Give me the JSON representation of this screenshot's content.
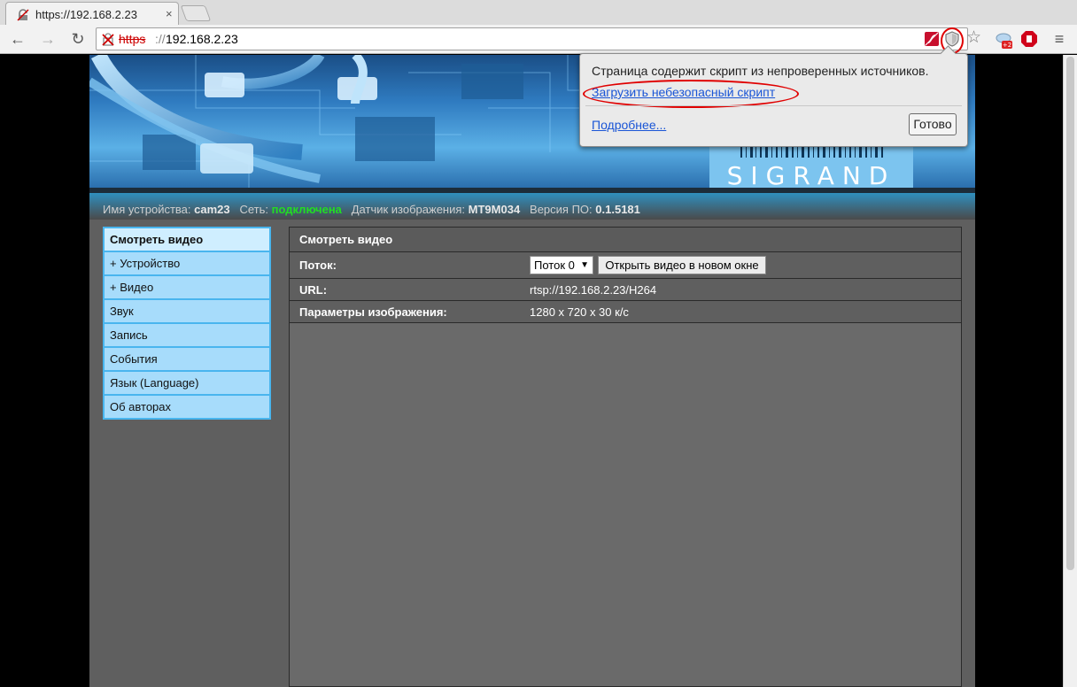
{
  "browser": {
    "tab_title": "https://192.168.2.23",
    "url_scheme": "https",
    "url_sep": "://",
    "url_host": "192.168.2.23",
    "tab_close": "×",
    "back_icon": "←",
    "forward_icon": "→",
    "reload_icon": "↻",
    "menu_icon": "≡",
    "star_icon": "☆"
  },
  "popup": {
    "message": "Страница содержит скрипт из непроверенных источников.",
    "load_unsafe_link": "Загрузить небезопасный скрипт",
    "more_link": "Подробнее...",
    "done_button": "Готово"
  },
  "header": {
    "logo_text": "SIGRAND",
    "device_name_label": "Имя устройства:",
    "device_name_value": "cam23",
    "network_label": "Сеть:",
    "network_value": "подключена",
    "sensor_label": "Датчик изображения:",
    "sensor_value": "MT9M034",
    "firmware_label": "Версия ПО:",
    "firmware_value": "0.1.5181"
  },
  "sidebar": {
    "items": [
      {
        "label": "Смотреть видео"
      },
      {
        "label": "+ Устройство"
      },
      {
        "label": "+ Видео"
      },
      {
        "label": "Звук"
      },
      {
        "label": "Запись"
      },
      {
        "label": "События"
      },
      {
        "label": "Язык (Language)"
      },
      {
        "label": "Об авторах"
      }
    ]
  },
  "panel": {
    "title": "Смотреть видео",
    "stream_label": "Поток:",
    "stream_select": "Поток 0",
    "open_button": "Открыть видео в новом окне",
    "url_label": "URL:",
    "url_value": "rtsp://192.168.2.23/H264",
    "params_label": "Параметры изображения:",
    "params_value": "1280 x 720 x 30 к/с"
  },
  "colors": {
    "network_ok": "#22dd22",
    "sidebar_bg": "#49b5ee",
    "popup_link": "#1a55d6",
    "annotation_red": "#e00000"
  }
}
